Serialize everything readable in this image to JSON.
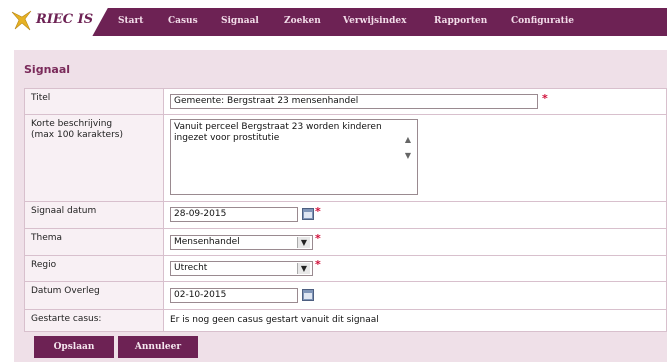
{
  "app": {
    "name": "RIEC IS"
  },
  "nav": {
    "items": [
      "Start",
      "Casus",
      "Signaal",
      "Zoeken",
      "Verwijsindex",
      "Rapporten",
      "Configuratie"
    ]
  },
  "page": {
    "title": "Signaal"
  },
  "form": {
    "titel": {
      "label": "Titel",
      "value": "Gemeente: Bergstraat 23 mensenhandel"
    },
    "korte_beschrijving": {
      "label_line1": "Korte beschrijving",
      "label_line2": "(max 100 karakters)",
      "value_line1": "Vanuit perceel Bergstraat 23 worden kinderen",
      "value_line2": "ingezet voor prostitutie"
    },
    "signaal_datum": {
      "label": "Signaal datum",
      "value": "28-09-2015"
    },
    "thema": {
      "label": "Thema",
      "value": "Mensenhandel"
    },
    "regio": {
      "label": "Regio",
      "value": "Utrecht"
    },
    "datum_overleg": {
      "label": "Datum Overleg",
      "value": "02-10-2015"
    },
    "gestarte_casus": {
      "label": "Gestarte casus:",
      "value": "Er is nog geen casus gestart vanuit dit signaal"
    },
    "required_marker": "*"
  },
  "buttons": {
    "save": "Opslaan",
    "cancel": "Annuleer"
  },
  "colors": {
    "brand": "#6d2254",
    "panel": "#efe0e8",
    "required": "#d0103a"
  },
  "icons": {
    "logo": "bird-logo-icon",
    "calendar": "calendar-icon",
    "dropdown": "chevron-down-icon"
  }
}
